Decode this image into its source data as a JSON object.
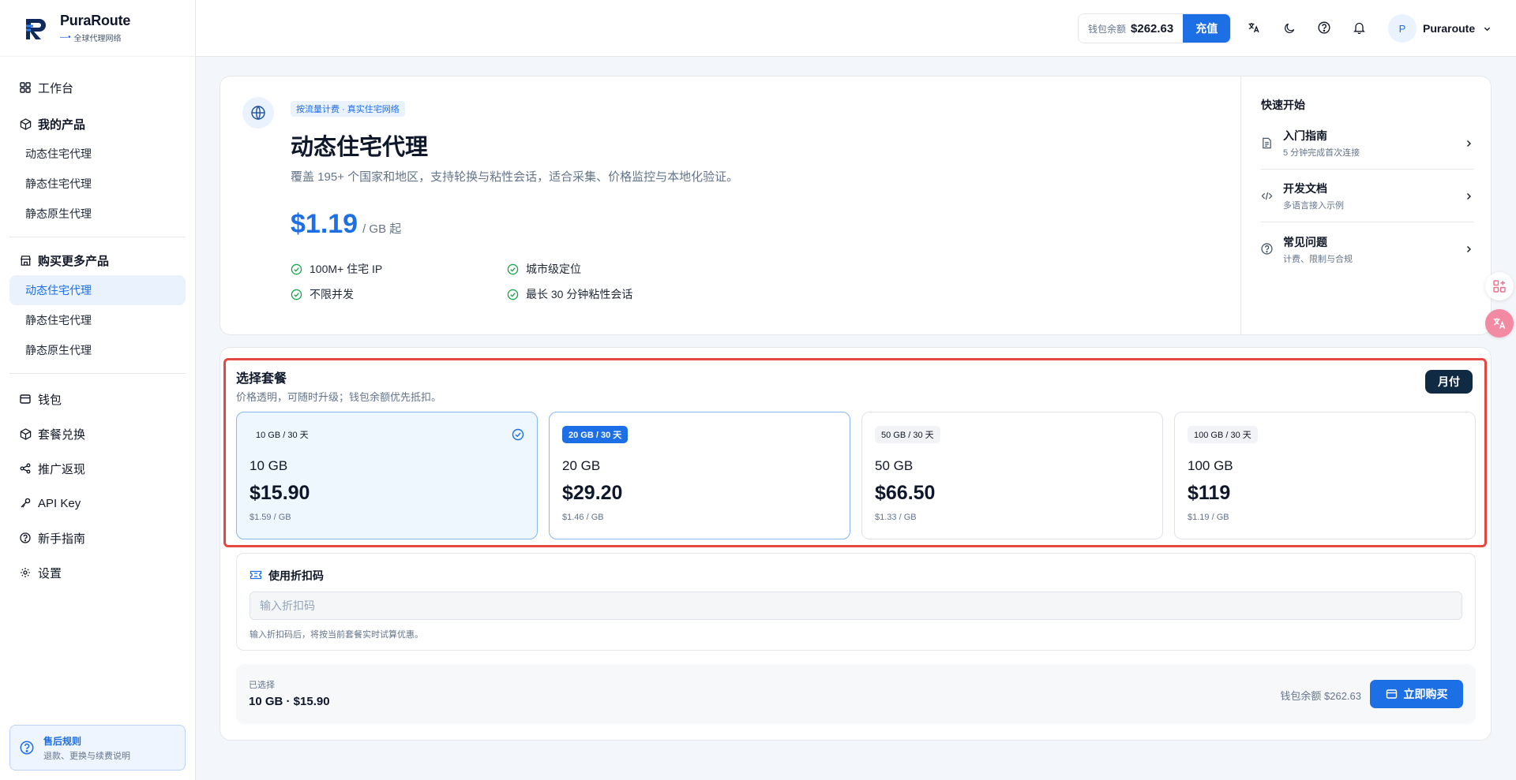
{
  "app": {
    "brand": "PuraRoute",
    "tagline": "全球代理网络"
  },
  "sidebar": {
    "workbench": "工作台",
    "my_products": {
      "label": "我的产品",
      "items": [
        "动态住宅代理",
        "静态住宅代理",
        "静态原生代理"
      ]
    },
    "buy_more": {
      "label": "购买更多产品",
      "items": [
        "动态住宅代理",
        "静态住宅代理",
        "静态原生代理"
      ],
      "active_index": 0
    },
    "bottom_items": [
      {
        "label": "钱包",
        "icon": "wallet-icon"
      },
      {
        "label": "套餐兑换",
        "icon": "package-icon"
      },
      {
        "label": "推广返现",
        "icon": "share-icon"
      },
      {
        "label": "API Key",
        "icon": "key-icon"
      },
      {
        "label": "新手指南",
        "icon": "help-circle-icon"
      },
      {
        "label": "设置",
        "icon": "gear-icon"
      }
    ],
    "after_sale": {
      "title": "售后规则",
      "subtitle": "退款、更换与续费说明"
    }
  },
  "topbar": {
    "wallet_label": "钱包余额",
    "wallet_amount": "$262.63",
    "recharge": "充值",
    "icons": [
      "translate-icon",
      "moon-icon",
      "help-circle-icon",
      "bell-icon"
    ],
    "user_initial": "P",
    "user_name": "Puraroute"
  },
  "hero": {
    "badge": "按流量计费 · 真实住宅网络",
    "title": "动态住宅代理",
    "description": "覆盖 195+ 个国家和地区，支持轮换与粘性会话，适合采集、价格监控与本地化验证。",
    "price": "$1.19",
    "price_unit": "/ GB 起",
    "features": [
      "100M+ 住宅 IP",
      "城市级定位",
      "不限并发",
      "最长 30 分钟粘性会话"
    ]
  },
  "quick_start": {
    "title": "快速开始",
    "items": [
      {
        "title": "入门指南",
        "subtitle": "5 分钟完成首次连接",
        "icon": "document-icon"
      },
      {
        "title": "开发文档",
        "subtitle": "多语言接入示例",
        "icon": "code-icon"
      },
      {
        "title": "常见问题",
        "subtitle": "计费、限制与合规",
        "icon": "help-circle-icon"
      }
    ]
  },
  "plans": {
    "title": "选择套餐",
    "subtitle": "价格透明，可随时升级；钱包余额优先抵扣。",
    "billing_toggle": "月付",
    "selected_index": 0,
    "items": [
      {
        "tag": "10 GB / 30 天",
        "gb": "10 GB",
        "price": "$15.90",
        "per_gb": "$1.59 / GB"
      },
      {
        "tag": "20 GB / 30 天",
        "gb": "20 GB",
        "price": "$29.20",
        "per_gb": "$1.46 / GB"
      },
      {
        "tag": "50 GB / 30 天",
        "gb": "50 GB",
        "price": "$66.50",
        "per_gb": "$1.33 / GB"
      },
      {
        "tag": "100 GB / 30 天",
        "gb": "100 GB",
        "price": "$119",
        "per_gb": "$1.19 / GB"
      }
    ]
  },
  "coupon": {
    "title": "使用折扣码",
    "placeholder": "输入折扣码",
    "value": "",
    "note": "输入折扣码后，将按当前套餐实时试算优惠。"
  },
  "summary": {
    "label": "已选择",
    "value": "10 GB · $15.90",
    "wallet_text": "钱包余额 $262.63",
    "buy": "立即购买"
  },
  "colors": {
    "accent": "#1d6fe6",
    "highlight_border": "#e5483f",
    "dark_button": "#112a44"
  }
}
